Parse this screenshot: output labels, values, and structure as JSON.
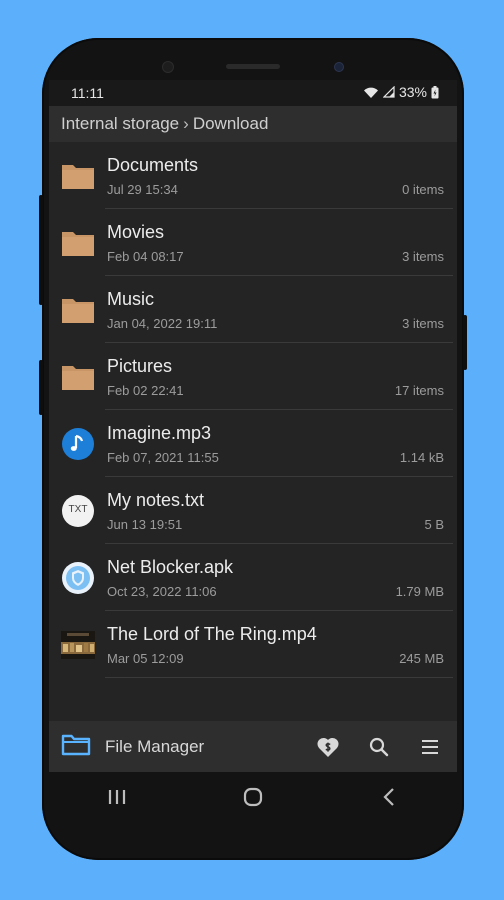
{
  "status_bar": {
    "time": "11:11",
    "battery": "33%"
  },
  "breadcrumb": {
    "root": "Internal storage",
    "separator": "›",
    "current": "Download"
  },
  "files": [
    {
      "name": "Documents",
      "date": "Jul 29 15:34",
      "meta": "0 items",
      "icon": "folder-icon"
    },
    {
      "name": "Movies",
      "date": "Feb 04 08:17",
      "meta": "3 items",
      "icon": "folder-icon"
    },
    {
      "name": "Music",
      "date": "Jan 04, 2022 19:11",
      "meta": "3 items",
      "icon": "folder-icon"
    },
    {
      "name": "Pictures",
      "date": "Feb 02 22:41",
      "meta": "17 items",
      "icon": "folder-icon"
    },
    {
      "name": "Imagine.mp3",
      "date": "Feb 07, 2021 11:55",
      "meta": "1.14 kB",
      "icon": "music-note-icon"
    },
    {
      "name": "My notes.txt",
      "date": "Jun 13 19:51",
      "meta": "5 B",
      "icon": "txt-file-icon"
    },
    {
      "name": "Net Blocker.apk",
      "date": "Oct 23, 2022 11:06",
      "meta": "1.79 MB",
      "icon": "shield-app-icon"
    },
    {
      "name": "The Lord of The Ring.mp4",
      "date": "Mar 05 12:09",
      "meta": "245 MB",
      "icon": "video-thumbnail-icon"
    }
  ],
  "txt_icon_label": "TXT",
  "bottom_bar": {
    "title": "File Manager",
    "actions": [
      "donate-heart-icon",
      "search-icon",
      "menu-icon"
    ]
  },
  "colors": {
    "background": "#5cb0fb",
    "folder": "#c89566",
    "accent": "#1e7fd8",
    "app_icon": "#5ab3ff"
  }
}
